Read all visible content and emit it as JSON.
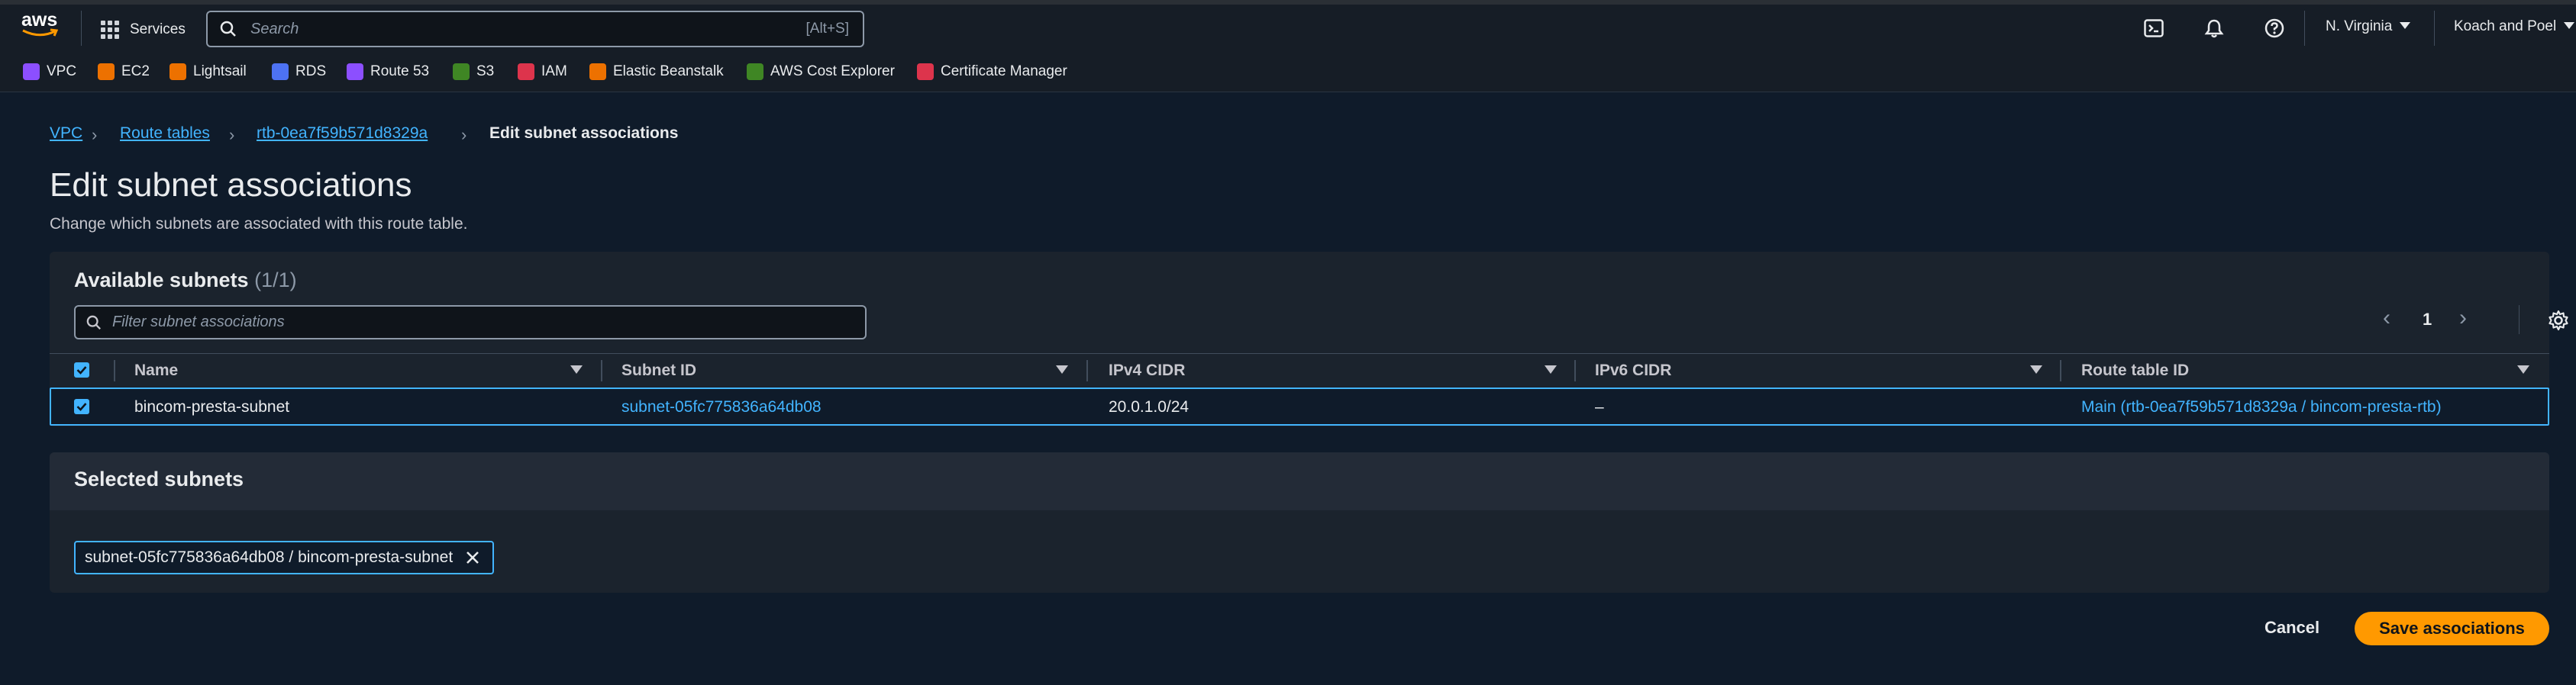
{
  "topbar": {
    "logo": "aws",
    "services_label": "Services",
    "search_placeholder": "Search",
    "search_shortcut": "[Alt+S]",
    "icons": [
      "cloudshell-icon",
      "notifications-icon",
      "help-icon"
    ],
    "region": "N. Virginia",
    "account": "Koach and Poel"
  },
  "favorites": [
    {
      "label": "VPC",
      "color": "#8c4fff"
    },
    {
      "label": "EC2",
      "color": "#ed7100"
    },
    {
      "label": "Lightsail",
      "color": "#ed7100"
    },
    {
      "label": "RDS",
      "color": "#4d72f3"
    },
    {
      "label": "Route 53",
      "color": "#8c4fff"
    },
    {
      "label": "S3",
      "color": "#3f8624"
    },
    {
      "label": "IAM",
      "color": "#dd344c"
    },
    {
      "label": "Elastic Beanstalk",
      "color": "#ed7100"
    },
    {
      "label": "AWS Cost Explorer",
      "color": "#3f8624"
    },
    {
      "label": "Certificate Manager",
      "color": "#dd344c"
    }
  ],
  "breadcrumb": {
    "items": [
      "VPC",
      "Route tables",
      "rtb-0ea7f59b571d8329a"
    ],
    "current": "Edit subnet associations"
  },
  "page": {
    "title": "Edit subnet associations",
    "description": "Change which subnets are associated with this route table."
  },
  "available": {
    "title": "Available subnets",
    "count": "(1/1)",
    "filter_placeholder": "Filter subnet associations",
    "page": "1",
    "columns": [
      "Name",
      "Subnet ID",
      "IPv4 CIDR",
      "IPv6 CIDR",
      "Route table ID"
    ],
    "rows": [
      {
        "name": "bincom-presta-subnet",
        "subnet_id": "subnet-05fc775836a64db08",
        "ipv4": "20.0.1.0/24",
        "ipv6": "–",
        "route_table": "Main (rtb-0ea7f59b571d8329a / bincom-presta-rtb)",
        "selected": true
      }
    ]
  },
  "selected": {
    "title": "Selected subnets",
    "tokens": [
      "subnet-05fc775836a64db08 / bincom-presta-subnet"
    ]
  },
  "actions": {
    "cancel": "Cancel",
    "save": "Save associations"
  },
  "colors": {
    "accent": "#42b4ff",
    "primary_button": "#ff9900",
    "background": "#0f1b2a"
  }
}
